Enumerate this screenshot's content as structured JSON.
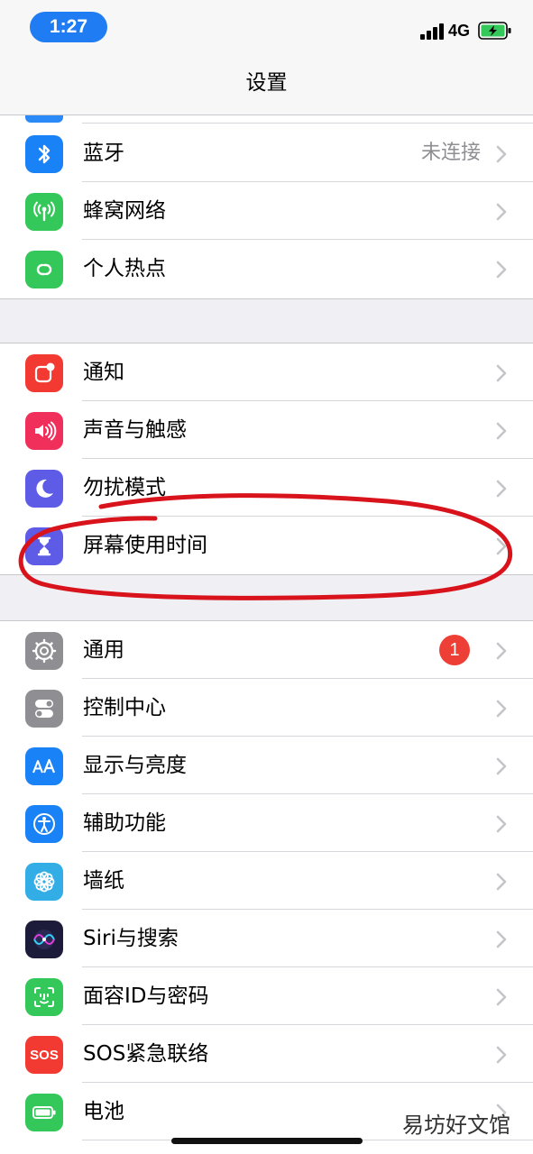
{
  "status_bar": {
    "time": "1:27",
    "network": "4G",
    "icons": [
      "signal-bars-icon",
      "battery-charging-icon"
    ]
  },
  "nav": {
    "title": "设置"
  },
  "group1": [
    {
      "label": "蓝牙",
      "value": "未连接",
      "icon": "bluetooth-icon",
      "color": "#1a82f7"
    },
    {
      "label": "蜂窝网络",
      "icon": "cellular-antenna-icon",
      "color": "#34c759"
    },
    {
      "label": "个人热点",
      "icon": "hotspot-link-icon",
      "color": "#34c759"
    }
  ],
  "group2": [
    {
      "label": "通知",
      "icon": "notification-icon",
      "color": "#f23a32"
    },
    {
      "label": "声音与触感",
      "icon": "speaker-icon",
      "color": "#f0305a"
    },
    {
      "label": "勿扰模式",
      "icon": "moon-icon",
      "color": "#5e5ce6"
    },
    {
      "label": "屏幕使用时间",
      "icon": "hourglass-icon",
      "color": "#5e5ce6"
    }
  ],
  "group3": [
    {
      "label": "通用",
      "badge": "1",
      "icon": "gear-icon",
      "color": "#8e8e93"
    },
    {
      "label": "控制中心",
      "icon": "toggles-icon",
      "color": "#8e8e93"
    },
    {
      "label": "显示与亮度",
      "icon": "text-size-icon",
      "color": "#1a82f7"
    },
    {
      "label": "辅助功能",
      "icon": "accessibility-icon",
      "color": "#1a82f7"
    },
    {
      "label": "墙纸",
      "icon": "flower-icon",
      "color": "#32ade6"
    },
    {
      "label": "Siri与搜索",
      "icon": "siri-icon",
      "color": "#1c1c3a"
    },
    {
      "label": "面容ID与密码",
      "icon": "face-id-icon",
      "color": "#34c759"
    },
    {
      "label": "SOS紧急联络",
      "icon": "sos-icon",
      "color": "#f23a32",
      "icon_text": "SOS"
    },
    {
      "label": "电池",
      "icon": "battery-icon",
      "color": "#34c759"
    }
  ],
  "watermark": "易坊好文馆",
  "annotation_color": "#d8131b"
}
